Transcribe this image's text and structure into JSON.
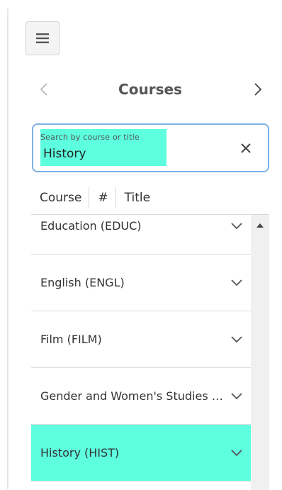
{
  "header": {
    "menu_icon": "hamburger-icon",
    "title": "Courses",
    "prev_icon": "chevron-left-icon",
    "next_icon": "chevron-right-icon"
  },
  "search": {
    "label": "Search by course or title",
    "value": "History",
    "clear_icon": "close-icon",
    "highlight_color": "#5dffdf",
    "focus_border_color": "#7fb0e4"
  },
  "columns": [
    "Course",
    "#",
    "Title"
  ],
  "subjects": [
    {
      "label": "Education (EDUC)",
      "highlighted": false
    },
    {
      "label": "English (ENGL)",
      "highlighted": false
    },
    {
      "label": "Film (FILM)",
      "highlighted": false
    },
    {
      "label": "Gender and Women's Studies (GWS)",
      "highlighted": false
    },
    {
      "label": "History (HIST)",
      "highlighted": true
    }
  ]
}
